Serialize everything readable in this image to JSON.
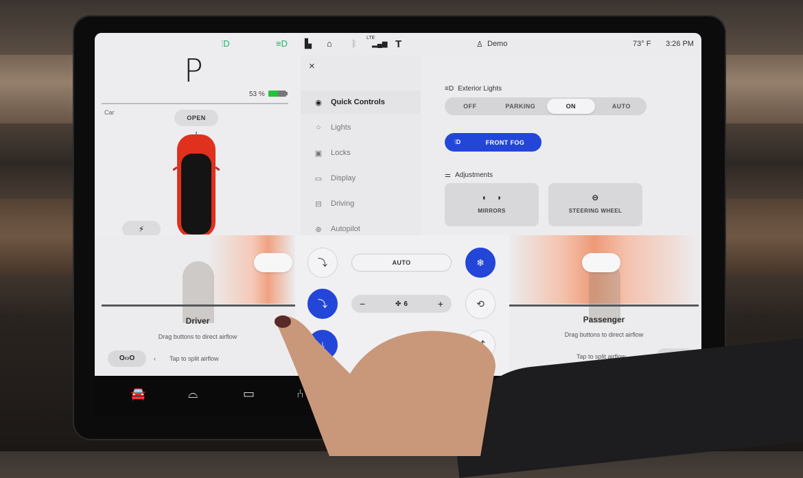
{
  "status_bar": {
    "left_icons": [
      "fog-light-icon",
      "headlight-icon"
    ],
    "center_icons": [
      "lock-icon",
      "homelink-icon",
      "bluetooth-icon",
      "lte-signal-icon",
      "tesla-logo-icon"
    ],
    "lte_label": "LTE",
    "profile_label": "Demo",
    "temperature": "73° F",
    "time": "3:26 PM",
    "colors": {
      "indicator_green": "#1fb46a"
    }
  },
  "car_panel": {
    "gear": "P",
    "battery_percent_label": "53 %",
    "battery_level": 0.53,
    "section_label": "Car",
    "frunk_button": "OPEN",
    "charge_port_icon": "⚡",
    "car_color": "#e0301e"
  },
  "menu": {
    "close_icon": "×",
    "items": [
      {
        "label": "Quick Controls",
        "icon": "toggle-icon",
        "glyph": "◉",
        "active": true
      },
      {
        "label": "Lights",
        "icon": "lightbulb-icon",
        "glyph": "💡",
        "active": false
      },
      {
        "label": "Locks",
        "icon": "lock-icon",
        "glyph": "🔒",
        "active": false
      },
      {
        "label": "Display",
        "icon": "display-icon",
        "glyph": "▭",
        "active": false
      },
      {
        "label": "Driving",
        "icon": "car-icon",
        "glyph": "🚘",
        "active": false
      },
      {
        "label": "Autopilot",
        "icon": "steering-wheel-icon",
        "glyph": "⊛",
        "active": false
      }
    ]
  },
  "quick_controls": {
    "exterior_lights": {
      "title": "Exterior Lights",
      "options": [
        "OFF",
        "PARKING",
        "ON",
        "AUTO"
      ],
      "selected": "ON"
    },
    "front_fog": {
      "label": "FRONT FOG",
      "active": true
    },
    "adjustments": {
      "title": "Adjustments",
      "cards": [
        {
          "label": "MIRRORS",
          "icon": "mirrors-icon"
        },
        {
          "label": "STEERING WHEEL",
          "icon": "steering-wheel-icon"
        }
      ]
    },
    "accent_color": "#2346d8"
  },
  "climate": {
    "driver": {
      "name": "Driver",
      "hint": "Drag buttons to direct airflow",
      "split_label": "Tap to split airflow",
      "split_icon": "O‹›O"
    },
    "passenger": {
      "name": "Passenger",
      "hint": "Drag buttons to direct airflow",
      "split_label": "Tap to split airflow",
      "split_icon": "O‹›O"
    },
    "auto_label": "AUTO",
    "fan": {
      "minus": "−",
      "plus": "+",
      "speed": "6"
    },
    "left_buttons": [
      {
        "name": "face-vent-icon",
        "active": false
      },
      {
        "name": "face-feet-vent-icon",
        "active": true
      },
      {
        "name": "feet-vent-icon",
        "active": true
      }
    ],
    "right_buttons": [
      {
        "name": "ac-snowflake-icon",
        "active": true
      },
      {
        "name": "recirculate-icon",
        "active": false
      },
      {
        "name": "defrost-vent-icon",
        "active": false
      }
    ]
  },
  "dock": {
    "icons": [
      "car-icon",
      "front-defrost-icon",
      "rear-defrost-icon",
      "seat-heater-icon"
    ]
  }
}
